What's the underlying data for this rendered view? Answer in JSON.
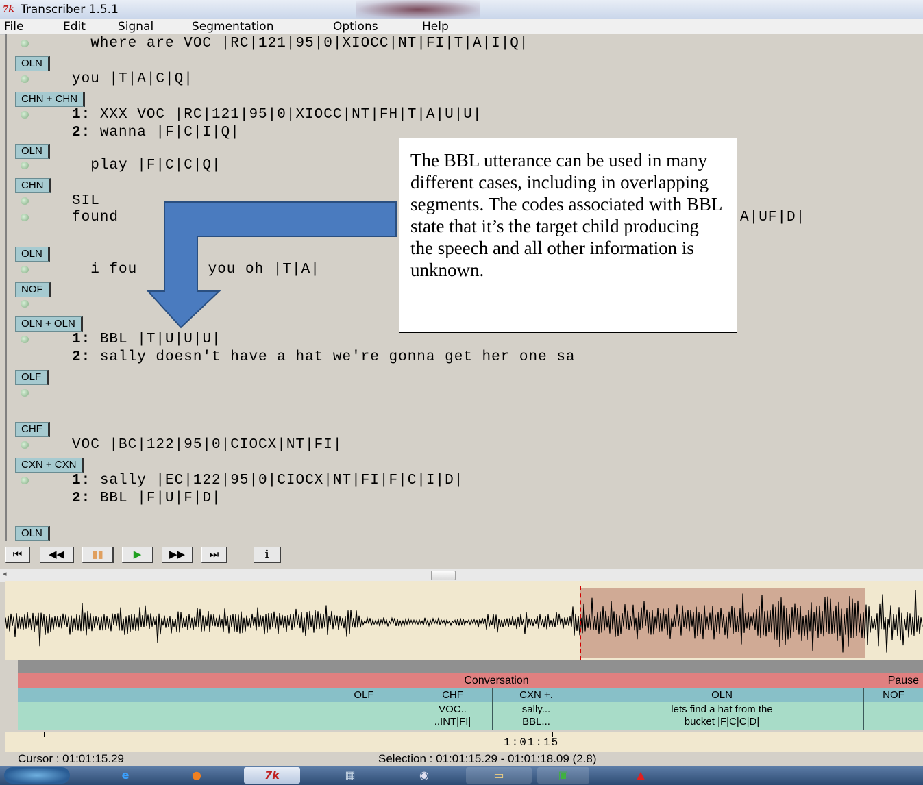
{
  "window": {
    "title": "Transcriber 1.5.1",
    "icon": "transcriber-app-icon"
  },
  "menu": [
    "File",
    "Edit",
    "Signal",
    "Segmentation",
    "Options",
    "Help"
  ],
  "transcript": {
    "lines": [
      {
        "text": "  where are VOC |RC|121|95|0|XIOCC|NT|FI|T|A|I|Q|"
      },
      {
        "tag": "OLN"
      },
      {
        "text": "you |T|A|C|Q|"
      },
      {
        "tag": "CHN + CHN"
      },
      {
        "num": "1:",
        "text": " XXX VOC |RC|121|95|0|XIOCC|NT|FH|T|A|U|U|"
      },
      {
        "num": "2:",
        "text": " wanna |F|C|I|Q|"
      },
      {
        "tag": "OLN"
      },
      {
        "text": "  play |F|C|C|Q|"
      },
      {
        "tag": "CHN"
      },
      {
        "text": "SIL"
      },
      {
        "text": "found ",
        "tail": "A|UF|D|"
      },
      {
        "tag": "OLN"
      },
      {
        "text": "  i fou",
        "mid": " you oh |T|A|"
      },
      {
        "tag": "NOF"
      },
      {
        "tag": "OLN + OLN"
      },
      {
        "num": "1:",
        "text": " BBL |T|U|U|U|"
      },
      {
        "num": "2:",
        "text": " sally doesn't have a hat we're gonna get her one sa"
      },
      {
        "tag": "OLF"
      },
      {
        "tag": "CHF"
      },
      {
        "text": "VOC |BC|122|95|0|CIOCX|NT|FI|"
      },
      {
        "tag": "CXN + CXN"
      },
      {
        "num": "1:",
        "text": " sally |EC|122|95|0|CIOCX|NT|FI|F|C|I|D|"
      },
      {
        "num": "2:",
        "text": " BBL |F|U|F|D|"
      },
      {
        "tag": "OLN"
      }
    ]
  },
  "callout": {
    "text": "The BBL utterance can be used in many different cases, including in overlapping segments. The codes associated with BBL state that it’s the target child producing the speech and all other information is unknown."
  },
  "transport": {
    "buttons": [
      {
        "name": "skip-start-button",
        "glyph": "⏮"
      },
      {
        "name": "rewind-button",
        "glyph": "◀◀"
      },
      {
        "name": "pause-button",
        "glyph": "▮▮"
      },
      {
        "name": "play-button",
        "glyph": "▶"
      },
      {
        "name": "fast-forward-button",
        "glyph": "▶▶"
      },
      {
        "name": "skip-end-button",
        "glyph": "⏭"
      },
      {
        "name": "info-button",
        "glyph": "ℹ"
      }
    ]
  },
  "tracks": {
    "topics": [
      {
        "label": "Conversation"
      },
      {
        "label": "Pause"
      }
    ],
    "speakers": [
      {
        "label": "OLF"
      },
      {
        "label": "CHF"
      },
      {
        "label": "CXN +."
      },
      {
        "label": "OLN"
      },
      {
        "label": "NOF"
      }
    ],
    "segments": [
      {
        "line1": "VOC..",
        "line2": "..INT|FI|"
      },
      {
        "line1": "sally...",
        "line2": "BBL..."
      },
      {
        "line1": "lets find a hat from the",
        "line2": "bucket |F|C|C|D|"
      }
    ]
  },
  "timeline": {
    "label": "1:01:15"
  },
  "status": {
    "cursor": "Cursor : 01:01:15.29",
    "selection": "Selection : 01:01:15.29 - 01:01:18.09 (2.8)"
  },
  "taskbar": {
    "items": [
      "start-orb",
      "ie-icon",
      "firefox-icon",
      "transcriber-icon",
      "calculator-icon",
      "paint-icon",
      "explorer-icon",
      "excel-icon",
      "acrobat-icon"
    ],
    "labels": {
      "transcriber": "7k"
    }
  },
  "colors": {
    "tag_bg": "#a6cad0",
    "topic_bg": "#e08080",
    "speaker_bg": "#88c0c8",
    "segment_bg": "#a8dcc8",
    "selection_bg": "#d0aa95",
    "cursor": "#d10000",
    "arrow_fill": "#4a7bbf"
  }
}
